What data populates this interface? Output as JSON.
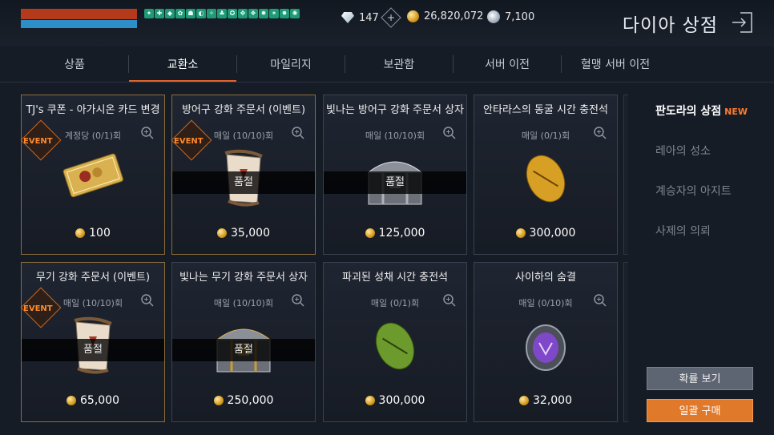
{
  "hud": {
    "buff_count": 15,
    "diamonds": "147",
    "gold": "26,820,072",
    "silver": "7,100"
  },
  "header": {
    "title": "다이아 상점"
  },
  "tabs": [
    "상품",
    "교환소",
    "마일리지",
    "보관함",
    "서버 이전",
    "혈맹 서버 이전"
  ],
  "active_tab": "교환소",
  "cards": [
    {
      "name": "TJ's 쿠폰 - 아가시온 카드 변경",
      "limit": "계정당 (0/1)회",
      "event": true,
      "sold_out": false,
      "price": "100",
      "art": "coupon",
      "selected": true
    },
    {
      "name": "방어구 강화 주문서 (이벤트)",
      "limit": "매일 (10/10)회",
      "event": true,
      "sold_out": true,
      "sold_out_label": "품절",
      "price": "35,000",
      "art": "scroll",
      "selected": true
    },
    {
      "name": "빛나는 방어구 강화 주문서 상자",
      "limit": "매일 (10/10)회",
      "event": false,
      "sold_out": true,
      "sold_out_label": "품절",
      "price": "125,000",
      "art": "chest",
      "selected": false
    },
    {
      "name": "안타라스의 동굴 시간 충전석",
      "limit": "매일 (0/1)회",
      "event": false,
      "sold_out": false,
      "price": "300,000",
      "art": "gold-stone",
      "selected": false
    },
    {
      "name": "무기 강화 주문서 (이벤트)",
      "limit": "매일 (10/10)회",
      "event": true,
      "sold_out": true,
      "sold_out_label": "품절",
      "price": "65,000",
      "art": "scroll",
      "selected": true
    },
    {
      "name": "빛나는 무기 강화 주문서 상자",
      "limit": "매일 (10/10)회",
      "event": false,
      "sold_out": true,
      "sold_out_label": "품절",
      "price": "250,000",
      "art": "chest-gold",
      "selected": false
    },
    {
      "name": "파괴된 성채 시간 충전석",
      "limit": "매일 (0/1)회",
      "event": false,
      "sold_out": false,
      "price": "300,000",
      "art": "green-stone",
      "selected": false
    },
    {
      "name": "사이하의 숨결",
      "limit": "매일 (0/10)회",
      "event": false,
      "sold_out": false,
      "price": "32,000",
      "art": "purple-orb",
      "selected": false
    }
  ],
  "event_label": "EVENT",
  "sidebar": {
    "items": [
      "판도라의 상점",
      "레아의 성소",
      "계승자의 아지트",
      "사제의 의뢰"
    ],
    "new_badge": "NEW"
  },
  "buttons": {
    "odds": "확률 보기",
    "bulk_buy": "일괄 구매"
  },
  "colors": {
    "accent": "#e2622a",
    "hp": "#b53a1b",
    "mp": "#2d8fc8",
    "buff": "#1e9b76"
  }
}
